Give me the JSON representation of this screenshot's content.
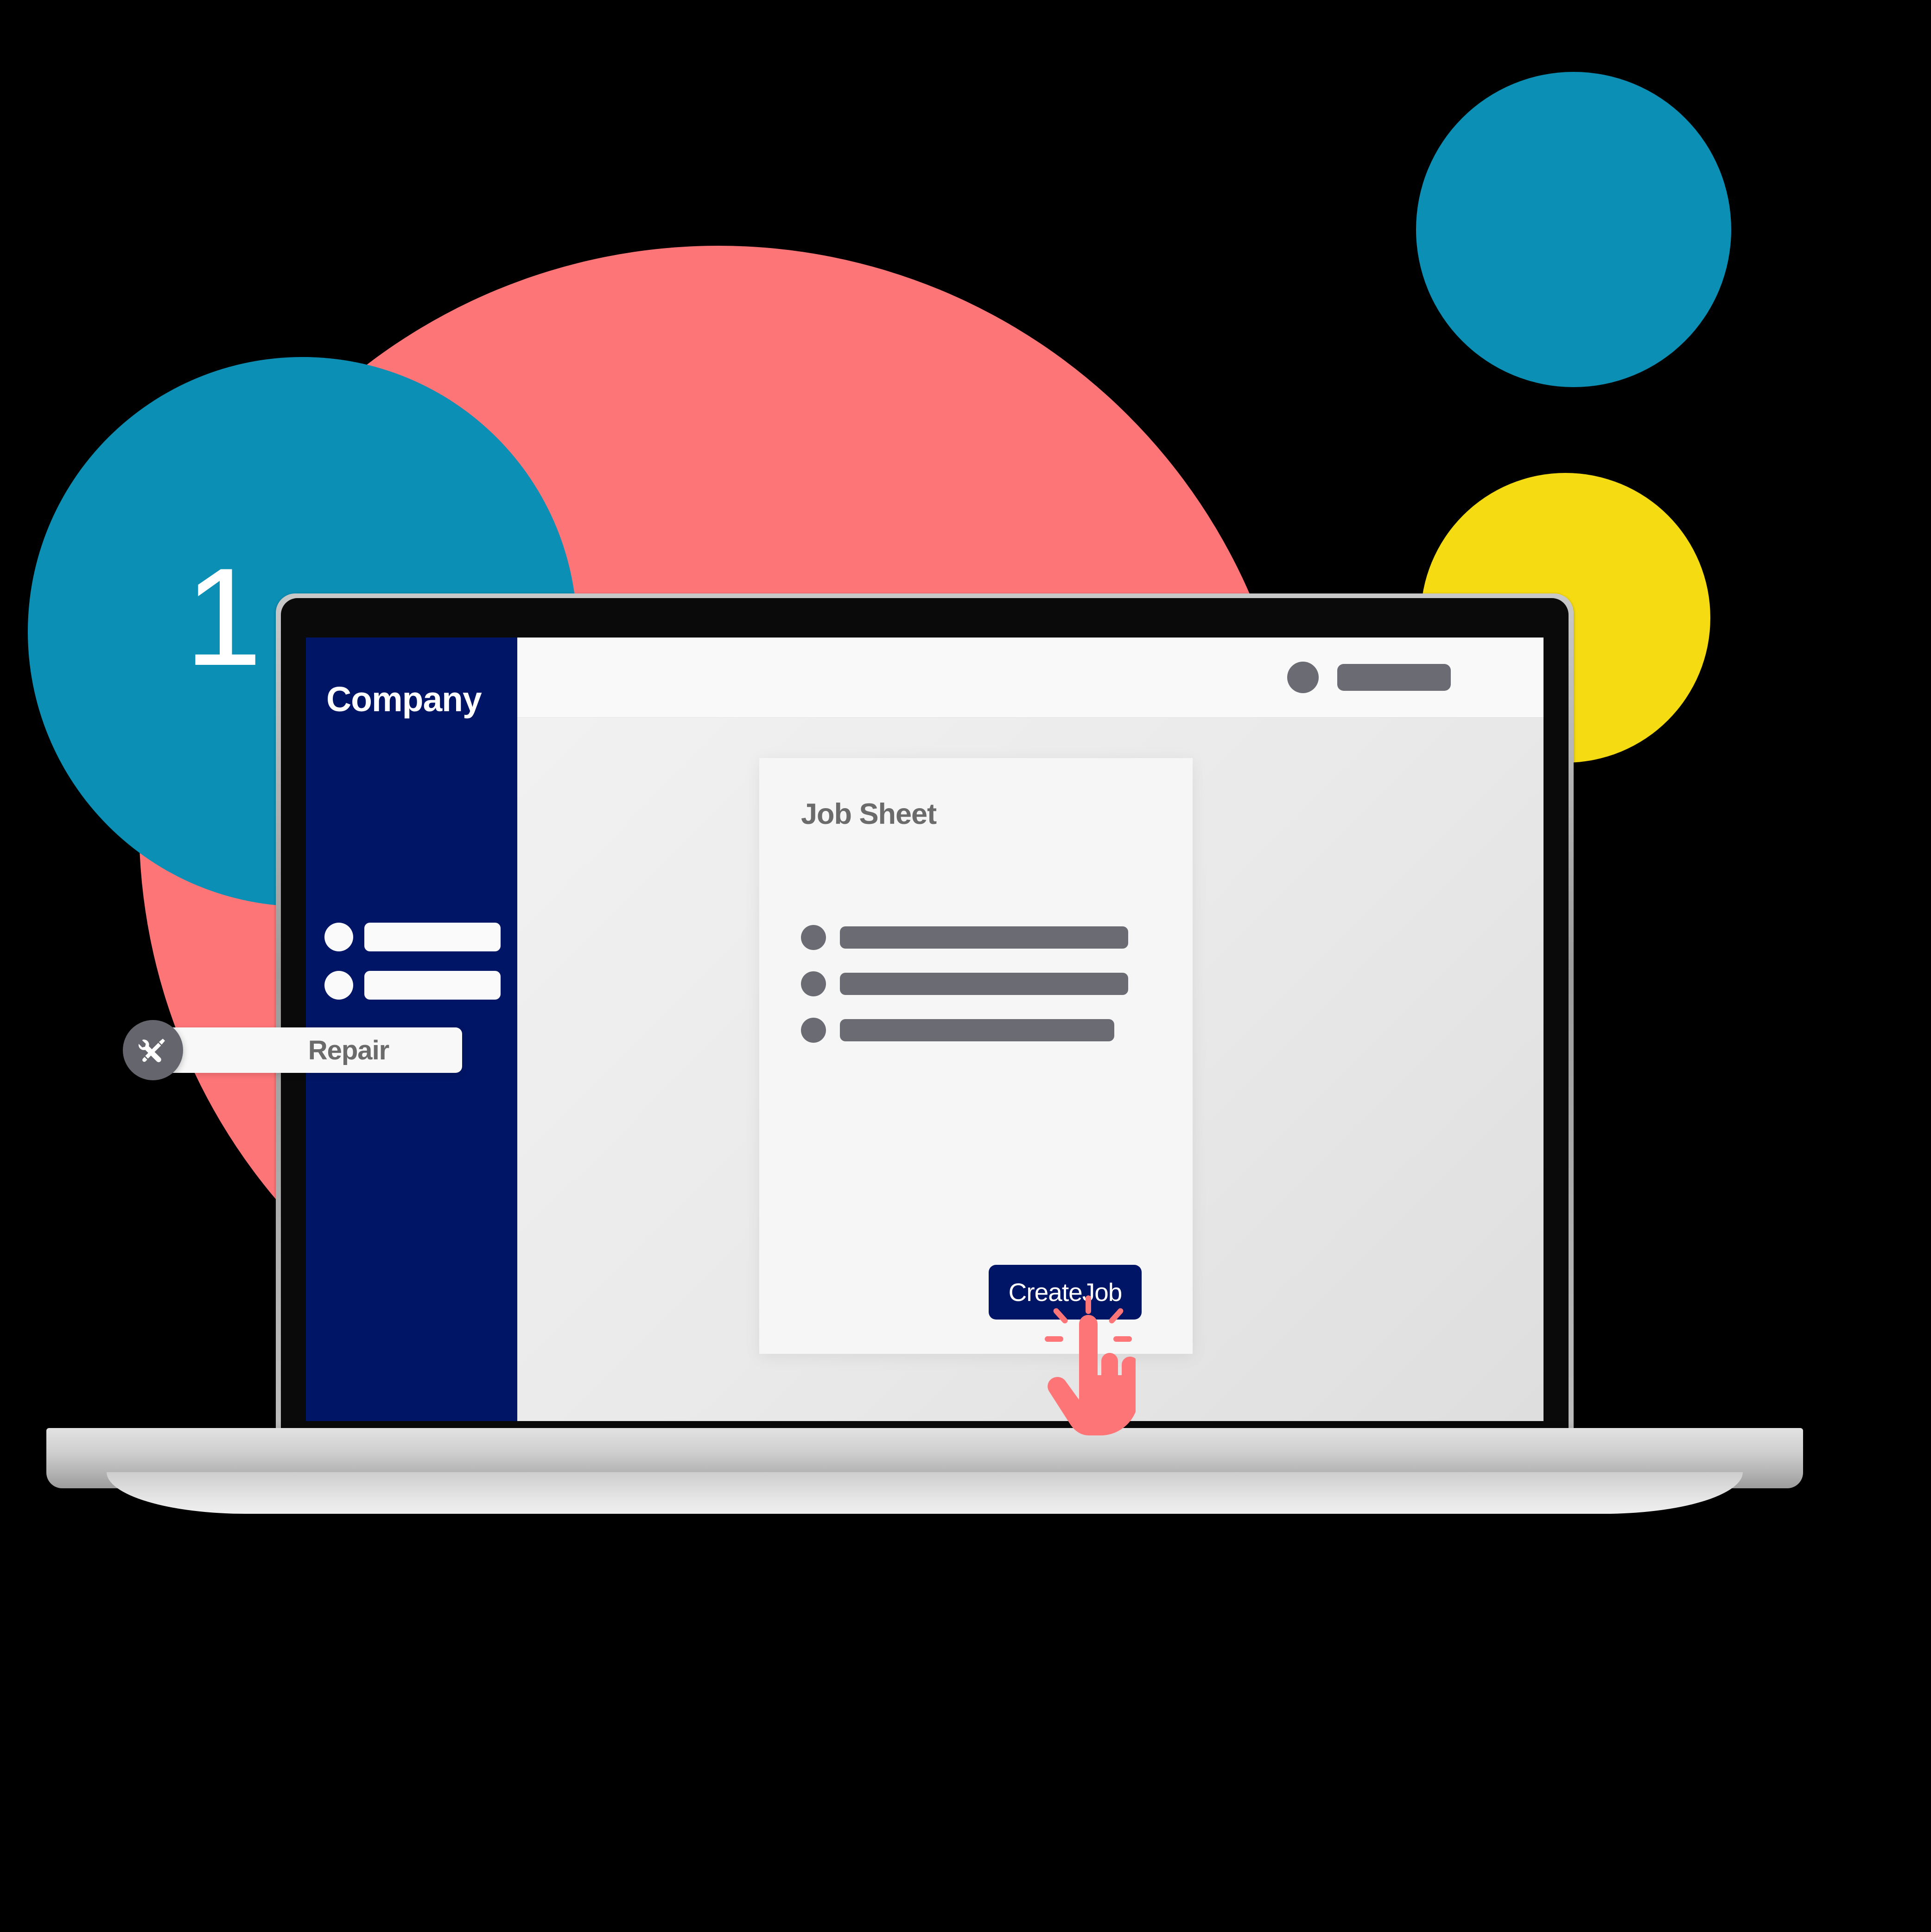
{
  "step": {
    "number": "1"
  },
  "decorations": {
    "coral_color": "#FE7578",
    "teal_color": "#0B8FB5",
    "yellow_color": "#F5DB11",
    "navy_color": "#011566"
  },
  "device": {
    "type": "laptop"
  },
  "app": {
    "sidebar": {
      "company_name": "Company",
      "nav_items": [
        {
          "icon": "bullet-icon",
          "label": ""
        },
        {
          "icon": "bullet-icon",
          "label": ""
        }
      ]
    },
    "topbar": {
      "avatar": "user-avatar",
      "name_placeholder": ""
    },
    "main": {
      "card": {
        "title": "Job Sheet",
        "rows": [
          {
            "bullet": "bullet-icon",
            "text": ""
          },
          {
            "bullet": "bullet-icon",
            "text": ""
          },
          {
            "bullet": "bullet-icon",
            "text": ""
          }
        ],
        "primary_button": "CreateJob"
      }
    }
  },
  "badge": {
    "icon": "tools-icon",
    "label": "Repair"
  }
}
